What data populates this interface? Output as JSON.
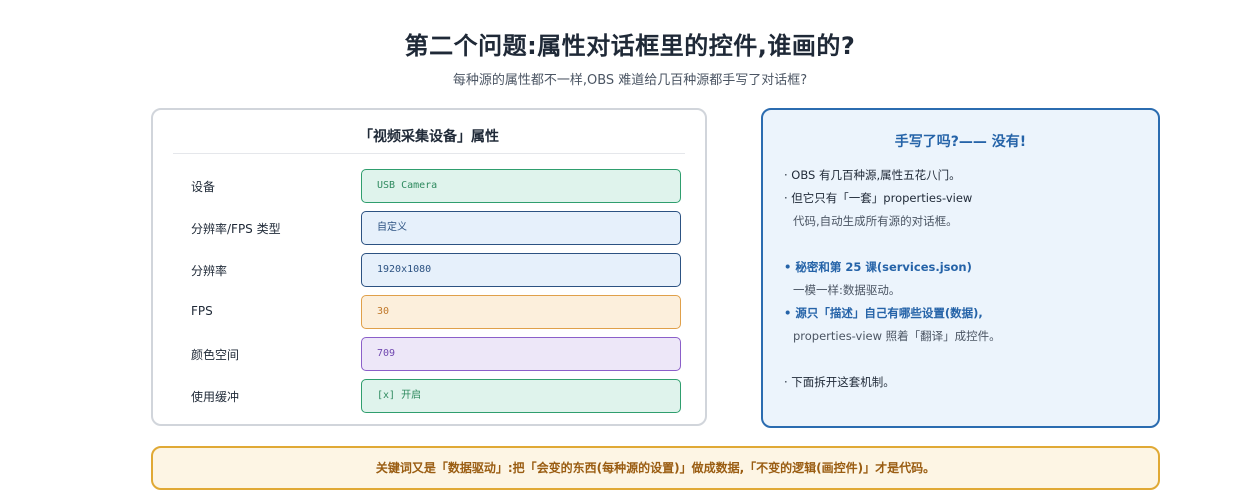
{
  "header": {
    "title": "第二个问题:属性对话框里的控件,谁画的?",
    "subtitle": "每种源的属性都不一样,OBS 难道给几百种源都手写了对话框?"
  },
  "dialog": {
    "title": "「视频采集设备」属性",
    "rows": [
      {
        "label": "设备",
        "value": "USB Camera",
        "bg": "#dff3ec",
        "border": "#2f9e6e",
        "color": "#2f8a5f"
      },
      {
        "label": "分辨率/FPS 类型",
        "value": "自定义",
        "bg": "#e6f0fb",
        "border": "#2c5282",
        "color": "#2c5282"
      },
      {
        "label": "分辨率",
        "value": "1920x1080",
        "bg": "#e6f0fb",
        "border": "#2c5282",
        "color": "#2c5282"
      },
      {
        "label": "FPS",
        "value": "30",
        "bg": "#fcefdc",
        "border": "#e0a04a",
        "color": "#c0782a"
      },
      {
        "label": "颜色空间",
        "value": "709",
        "bg": "#ede7f8",
        "border": "#8b5fc9",
        "color": "#7048b0"
      },
      {
        "label": "使用缓冲",
        "value": "[x] 开启",
        "bg": "#dff3ec",
        "border": "#2f9e6e",
        "color": "#2f8a5f"
      }
    ]
  },
  "panel": {
    "title": "手写了吗?—— 没有!",
    "lines": [
      {
        "text": "· OBS 有几百种源,属性五花八门。",
        "style": ""
      },
      {
        "text": "· 但它只有「一套」properties-view",
        "style": ""
      },
      {
        "text": "代码,自动生成所有源的对话框。",
        "style": "indent"
      },
      {
        "text": "• 秘密和第 25 课(services.json)",
        "style": "strong"
      },
      {
        "text": "一模一样:数据驱动。",
        "style": "indent"
      },
      {
        "text": "• 源只「描述」自己有哪些设置(数据),",
        "style": "strong"
      },
      {
        "text": "properties-view 照着「翻译」成控件。",
        "style": "indent"
      },
      {
        "text": "· 下面拆开这套机制。",
        "style": ""
      }
    ]
  },
  "banner": {
    "text": "关键词又是「数据驱动」:把「会变的东西(每种源的设置)」做成数据,「不变的逻辑(画控件)」才是代码。"
  }
}
